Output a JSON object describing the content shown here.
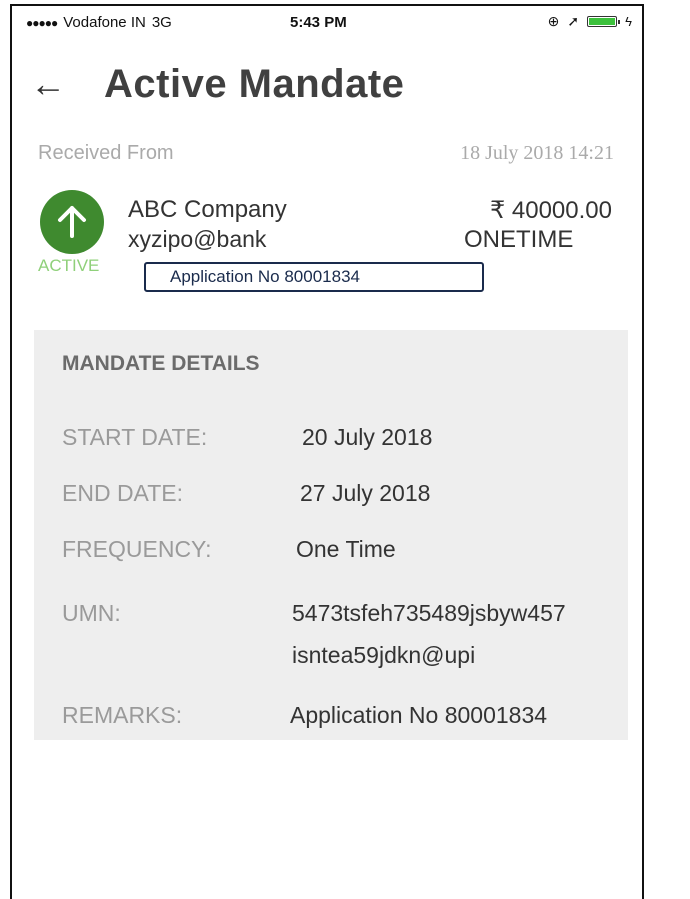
{
  "status_bar": {
    "carrier": "Vodafone IN",
    "network": "3G",
    "time": "5:43 PM"
  },
  "header": {
    "back_icon": "←",
    "title": "Active Mandate"
  },
  "received": {
    "label": "Received From",
    "datetime": "18 July 2018 14:21"
  },
  "mandate": {
    "status": "ACTIVE",
    "status_color": "#3f8a2f",
    "payee_name": "ABC Company",
    "payee_vpa": "xyzipo@bank",
    "amount": "₹ 40000.00",
    "type": "ONETIME",
    "application_note": "Application No 80001834"
  },
  "details": {
    "heading": "MANDATE DETAILS",
    "start_date_label": "START DATE:",
    "start_date_value": "20 July 2018",
    "end_date_label": "END DATE:",
    "end_date_value": "27 July 2018",
    "frequency_label": "FREQUENCY:",
    "frequency_value": "One Time",
    "umn_label": "UMN:",
    "umn_line1": "5473tsfeh735489jsbyw457",
    "umn_line2": "isntea59jdkn@upi",
    "remarks_label": "REMARKS:",
    "remarks_value": "Application No 80001834"
  }
}
